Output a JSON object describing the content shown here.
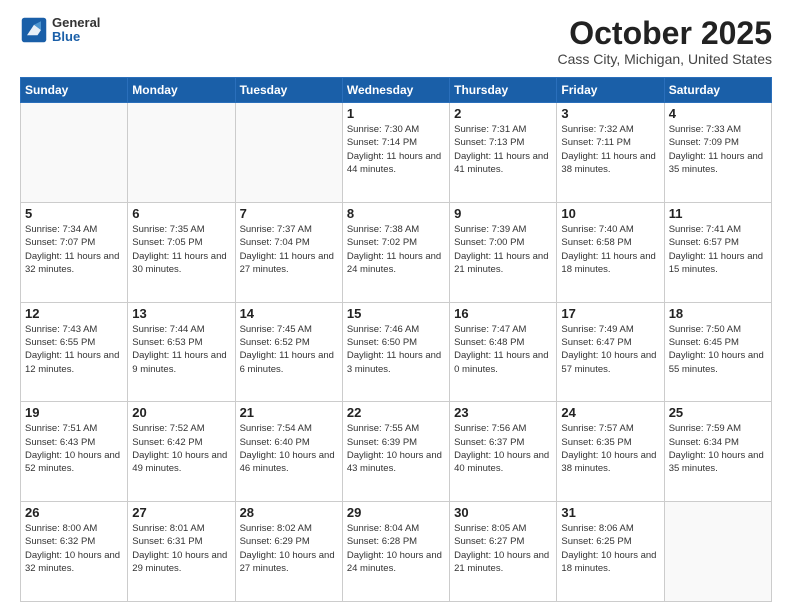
{
  "header": {
    "logo_general": "General",
    "logo_blue": "Blue",
    "main_title": "October 2025",
    "subtitle": "Cass City, Michigan, United States"
  },
  "days_of_week": [
    "Sunday",
    "Monday",
    "Tuesday",
    "Wednesday",
    "Thursday",
    "Friday",
    "Saturday"
  ],
  "weeks": [
    [
      {
        "day": "",
        "sunrise": "",
        "sunset": "",
        "daylight": ""
      },
      {
        "day": "",
        "sunrise": "",
        "sunset": "",
        "daylight": ""
      },
      {
        "day": "",
        "sunrise": "",
        "sunset": "",
        "daylight": ""
      },
      {
        "day": "1",
        "sunrise": "Sunrise: 7:30 AM",
        "sunset": "Sunset: 7:14 PM",
        "daylight": "Daylight: 11 hours and 44 minutes."
      },
      {
        "day": "2",
        "sunrise": "Sunrise: 7:31 AM",
        "sunset": "Sunset: 7:13 PM",
        "daylight": "Daylight: 11 hours and 41 minutes."
      },
      {
        "day": "3",
        "sunrise": "Sunrise: 7:32 AM",
        "sunset": "Sunset: 7:11 PM",
        "daylight": "Daylight: 11 hours and 38 minutes."
      },
      {
        "day": "4",
        "sunrise": "Sunrise: 7:33 AM",
        "sunset": "Sunset: 7:09 PM",
        "daylight": "Daylight: 11 hours and 35 minutes."
      }
    ],
    [
      {
        "day": "5",
        "sunrise": "Sunrise: 7:34 AM",
        "sunset": "Sunset: 7:07 PM",
        "daylight": "Daylight: 11 hours and 32 minutes."
      },
      {
        "day": "6",
        "sunrise": "Sunrise: 7:35 AM",
        "sunset": "Sunset: 7:05 PM",
        "daylight": "Daylight: 11 hours and 30 minutes."
      },
      {
        "day": "7",
        "sunrise": "Sunrise: 7:37 AM",
        "sunset": "Sunset: 7:04 PM",
        "daylight": "Daylight: 11 hours and 27 minutes."
      },
      {
        "day": "8",
        "sunrise": "Sunrise: 7:38 AM",
        "sunset": "Sunset: 7:02 PM",
        "daylight": "Daylight: 11 hours and 24 minutes."
      },
      {
        "day": "9",
        "sunrise": "Sunrise: 7:39 AM",
        "sunset": "Sunset: 7:00 PM",
        "daylight": "Daylight: 11 hours and 21 minutes."
      },
      {
        "day": "10",
        "sunrise": "Sunrise: 7:40 AM",
        "sunset": "Sunset: 6:58 PM",
        "daylight": "Daylight: 11 hours and 18 minutes."
      },
      {
        "day": "11",
        "sunrise": "Sunrise: 7:41 AM",
        "sunset": "Sunset: 6:57 PM",
        "daylight": "Daylight: 11 hours and 15 minutes."
      }
    ],
    [
      {
        "day": "12",
        "sunrise": "Sunrise: 7:43 AM",
        "sunset": "Sunset: 6:55 PM",
        "daylight": "Daylight: 11 hours and 12 minutes."
      },
      {
        "day": "13",
        "sunrise": "Sunrise: 7:44 AM",
        "sunset": "Sunset: 6:53 PM",
        "daylight": "Daylight: 11 hours and 9 minutes."
      },
      {
        "day": "14",
        "sunrise": "Sunrise: 7:45 AM",
        "sunset": "Sunset: 6:52 PM",
        "daylight": "Daylight: 11 hours and 6 minutes."
      },
      {
        "day": "15",
        "sunrise": "Sunrise: 7:46 AM",
        "sunset": "Sunset: 6:50 PM",
        "daylight": "Daylight: 11 hours and 3 minutes."
      },
      {
        "day": "16",
        "sunrise": "Sunrise: 7:47 AM",
        "sunset": "Sunset: 6:48 PM",
        "daylight": "Daylight: 11 hours and 0 minutes."
      },
      {
        "day": "17",
        "sunrise": "Sunrise: 7:49 AM",
        "sunset": "Sunset: 6:47 PM",
        "daylight": "Daylight: 10 hours and 57 minutes."
      },
      {
        "day": "18",
        "sunrise": "Sunrise: 7:50 AM",
        "sunset": "Sunset: 6:45 PM",
        "daylight": "Daylight: 10 hours and 55 minutes."
      }
    ],
    [
      {
        "day": "19",
        "sunrise": "Sunrise: 7:51 AM",
        "sunset": "Sunset: 6:43 PM",
        "daylight": "Daylight: 10 hours and 52 minutes."
      },
      {
        "day": "20",
        "sunrise": "Sunrise: 7:52 AM",
        "sunset": "Sunset: 6:42 PM",
        "daylight": "Daylight: 10 hours and 49 minutes."
      },
      {
        "day": "21",
        "sunrise": "Sunrise: 7:54 AM",
        "sunset": "Sunset: 6:40 PM",
        "daylight": "Daylight: 10 hours and 46 minutes."
      },
      {
        "day": "22",
        "sunrise": "Sunrise: 7:55 AM",
        "sunset": "Sunset: 6:39 PM",
        "daylight": "Daylight: 10 hours and 43 minutes."
      },
      {
        "day": "23",
        "sunrise": "Sunrise: 7:56 AM",
        "sunset": "Sunset: 6:37 PM",
        "daylight": "Daylight: 10 hours and 40 minutes."
      },
      {
        "day": "24",
        "sunrise": "Sunrise: 7:57 AM",
        "sunset": "Sunset: 6:35 PM",
        "daylight": "Daylight: 10 hours and 38 minutes."
      },
      {
        "day": "25",
        "sunrise": "Sunrise: 7:59 AM",
        "sunset": "Sunset: 6:34 PM",
        "daylight": "Daylight: 10 hours and 35 minutes."
      }
    ],
    [
      {
        "day": "26",
        "sunrise": "Sunrise: 8:00 AM",
        "sunset": "Sunset: 6:32 PM",
        "daylight": "Daylight: 10 hours and 32 minutes."
      },
      {
        "day": "27",
        "sunrise": "Sunrise: 8:01 AM",
        "sunset": "Sunset: 6:31 PM",
        "daylight": "Daylight: 10 hours and 29 minutes."
      },
      {
        "day": "28",
        "sunrise": "Sunrise: 8:02 AM",
        "sunset": "Sunset: 6:29 PM",
        "daylight": "Daylight: 10 hours and 27 minutes."
      },
      {
        "day": "29",
        "sunrise": "Sunrise: 8:04 AM",
        "sunset": "Sunset: 6:28 PM",
        "daylight": "Daylight: 10 hours and 24 minutes."
      },
      {
        "day": "30",
        "sunrise": "Sunrise: 8:05 AM",
        "sunset": "Sunset: 6:27 PM",
        "daylight": "Daylight: 10 hours and 21 minutes."
      },
      {
        "day": "31",
        "sunrise": "Sunrise: 8:06 AM",
        "sunset": "Sunset: 6:25 PM",
        "daylight": "Daylight: 10 hours and 18 minutes."
      },
      {
        "day": "",
        "sunrise": "",
        "sunset": "",
        "daylight": ""
      }
    ]
  ]
}
